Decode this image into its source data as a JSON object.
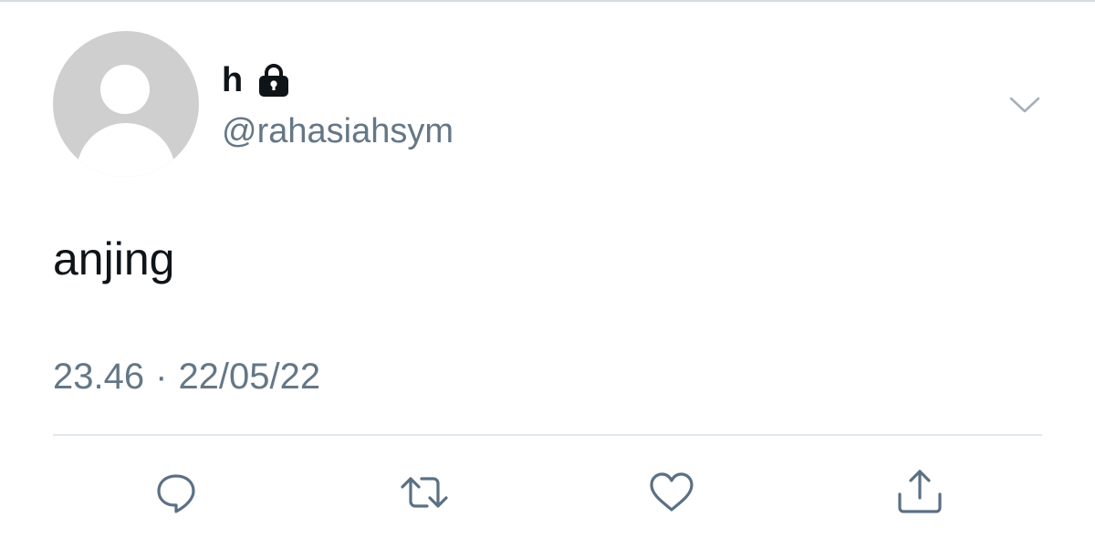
{
  "tweet": {
    "author": {
      "display_name": "h",
      "handle": "@rahasiahsym",
      "protected_icon": "lock-icon",
      "avatar": "default-avatar"
    },
    "text": "anjing",
    "time": "23.46",
    "separator": "·",
    "date": "22/05/22",
    "menu_icon": "chevron-down-icon"
  },
  "actions": [
    {
      "icon": "reply-icon"
    },
    {
      "icon": "retweet-icon"
    },
    {
      "icon": "like-icon"
    },
    {
      "icon": "share-icon"
    }
  ],
  "colors": {
    "primary_text": "#0f1419",
    "secondary_text": "#657786",
    "icon": "#5b7083",
    "divider": "#e1e8ed",
    "avatar_bg": "#cfcfcf"
  }
}
